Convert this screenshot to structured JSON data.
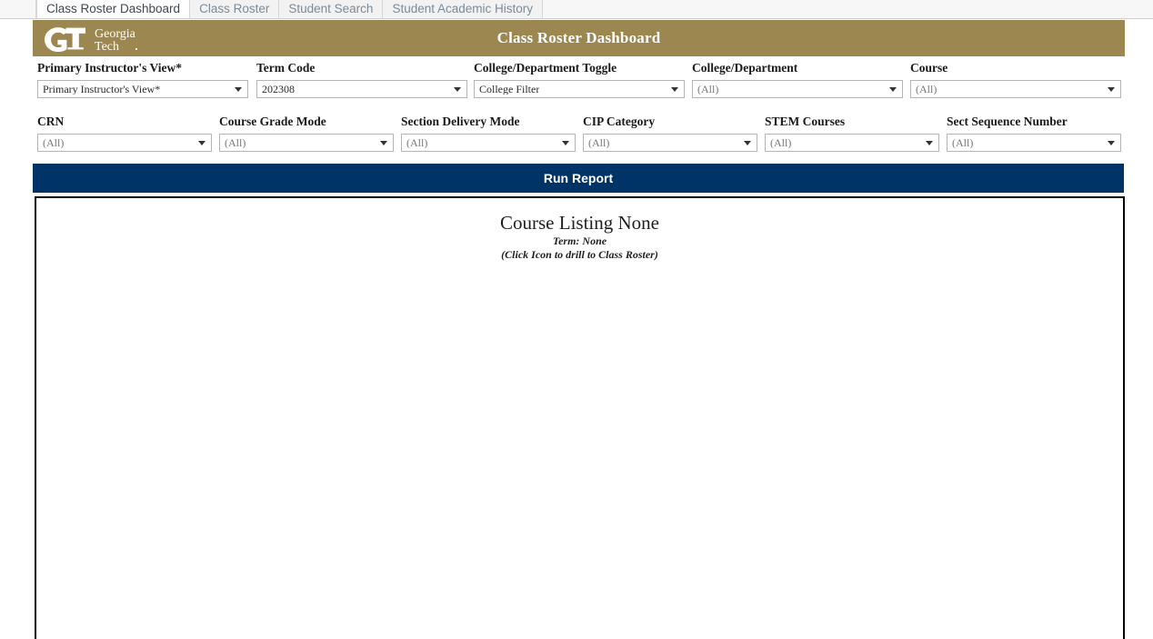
{
  "tabs": [
    {
      "label": "Class Roster Dashboard",
      "active": true
    },
    {
      "label": "Class Roster",
      "active": false
    },
    {
      "label": "Student Search",
      "active": false
    },
    {
      "label": "Student Academic History",
      "active": false
    }
  ],
  "header": {
    "title": "Class Roster Dashboard",
    "logo_line1": "Georgia",
    "logo_line2": "Tech",
    "background_color": "#9c8750",
    "text_color": "#ffffff"
  },
  "filters_row1": [
    {
      "label": "Primary Instructor's View*",
      "value": "Primary Instructor's View*",
      "muted": false
    },
    {
      "label": "Term Code",
      "value": "202308",
      "muted": false
    },
    {
      "label": "College/Department Toggle",
      "value": "College Filter",
      "muted": false
    },
    {
      "label": "College/Department",
      "value": "(All)",
      "muted": true
    },
    {
      "label": "Course",
      "value": "(All)",
      "muted": true
    }
  ],
  "filters_row2": [
    {
      "label": "CRN",
      "value": "(All)",
      "muted": true
    },
    {
      "label": "Course Grade Mode",
      "value": "(All)",
      "muted": true
    },
    {
      "label": "Section Delivery Mode",
      "value": "(All)",
      "muted": true
    },
    {
      "label": "CIP Category",
      "value": "(All)",
      "muted": true
    },
    {
      "label": "STEM Courses",
      "value": "(All)",
      "muted": true
    },
    {
      "label": "Sect Sequence Number",
      "value": "(All)",
      "muted": true
    }
  ],
  "run_report": {
    "label": "Run Report",
    "background_color": "#003366"
  },
  "report": {
    "title": "Course Listing None",
    "term": "Term: None",
    "hint": "(Click Icon to drill to Class Roster)"
  }
}
